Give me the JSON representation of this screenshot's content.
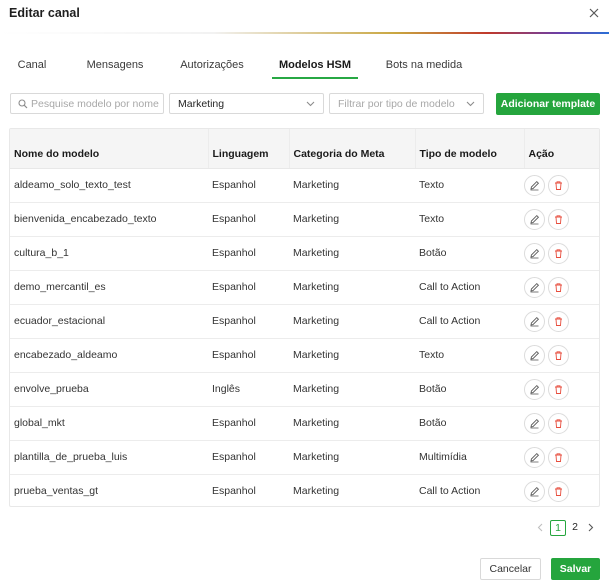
{
  "modal": {
    "title": "Editar canal"
  },
  "tabs": [
    {
      "label": "Canal"
    },
    {
      "label": "Mensagens"
    },
    {
      "label": "Autorizações"
    },
    {
      "label": "Modelos HSM"
    },
    {
      "label": "Bots na medida"
    }
  ],
  "active_tab": "Modelos HSM",
  "filters": {
    "search_placeholder": "Pesquise modelo por nome",
    "search_value": "",
    "category_value": "Marketing",
    "type_placeholder": "Filtrar por tipo de modelo",
    "add_label": "Adicionar template"
  },
  "table": {
    "columns": [
      "Nome do modelo",
      "Linguagem",
      "Categoria do Meta",
      "Tipo de modelo",
      "Ação"
    ],
    "rows": [
      [
        "aldeamo_solo_texto_test",
        "Espanhol",
        "Marketing",
        "Texto"
      ],
      [
        "bienvenida_encabezado_texto",
        "Espanhol",
        "Marketing",
        "Texto"
      ],
      [
        "cultura_b_1",
        "Espanhol",
        "Marketing",
        "Botão"
      ],
      [
        "demo_mercantil_es",
        "Espanhol",
        "Marketing",
        "Call to Action"
      ],
      [
        "ecuador_estacional",
        "Espanhol",
        "Marketing",
        "Call to Action"
      ],
      [
        "encabezado_aldeamo",
        "Espanhol",
        "Marketing",
        "Texto"
      ],
      [
        "envolve_prueba",
        "Inglês",
        "Marketing",
        "Botão"
      ],
      [
        "global_mkt",
        "Espanhol",
        "Marketing",
        "Botão"
      ],
      [
        "plantilla_de_prueba_luis",
        "Espanhol",
        "Marketing",
        "Multimídia"
      ],
      [
        "prueba_ventas_gt",
        "Espanhol",
        "Marketing",
        "Call to Action"
      ]
    ]
  },
  "pagination": {
    "pages": [
      "1",
      "2"
    ],
    "current": "1"
  },
  "footer": {
    "cancel_label": "Cancelar",
    "save_label": "Salvar"
  },
  "colors": {
    "accent": "#25a53d",
    "delete": "#e74c3c"
  }
}
